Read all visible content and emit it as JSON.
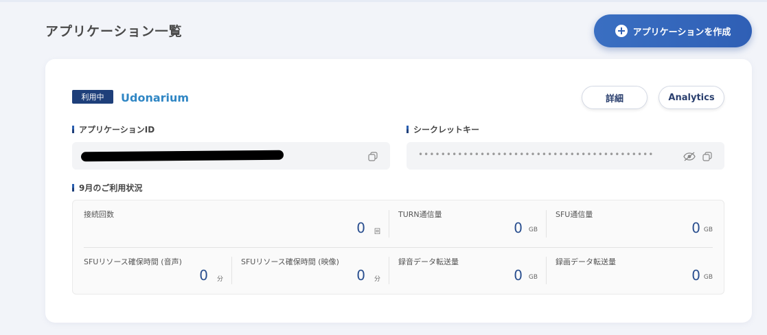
{
  "page": {
    "title": "アプリケーション一覧"
  },
  "header": {
    "create_button_label": "アプリケーションを作成"
  },
  "app": {
    "status": "利用中",
    "name": "Udonarium",
    "detail_button": "詳細",
    "analytics_button": "Analytics",
    "app_id_label": "アプリケーションID",
    "secret_key_label": "シークレットキー",
    "secret_key_masked": "••••••••••••••••••••••••••••••••••••••••••"
  },
  "usage": {
    "title": "9月のご利用状況",
    "stats": [
      {
        "label": "接続回数",
        "value": "0",
        "unit": "回"
      },
      {
        "label": "TURN通信量",
        "value": "0",
        "unit": "GB"
      },
      {
        "label": "SFU通信量",
        "value": "0",
        "unit": "GB"
      },
      {
        "label": "SFUリソース確保時間 (音声)",
        "value": "0",
        "unit": "分"
      },
      {
        "label": "SFUリソース確保時間 (映像)",
        "value": "0",
        "unit": "分"
      },
      {
        "label": "録音データ転送量",
        "value": "0",
        "unit": "GB"
      },
      {
        "label": "録画データ転送量",
        "value": "0",
        "unit": "GB"
      }
    ]
  },
  "icons": {
    "plus": "plus-icon",
    "copy": "copy-icon",
    "eye_off": "eye-off-icon"
  },
  "colors": {
    "accent": "#2f5fb5",
    "badge": "#1e3f7a",
    "app_name": "#2f86c4"
  }
}
